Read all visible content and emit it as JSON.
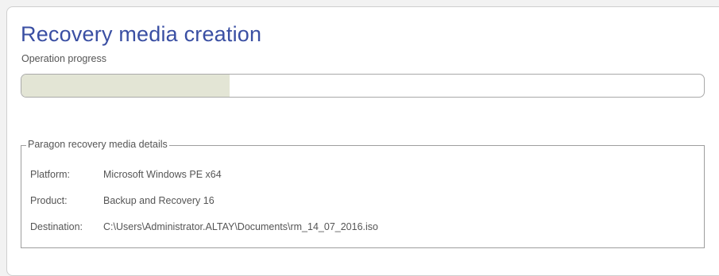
{
  "page": {
    "title": "Recovery media creation",
    "subtitle": "Operation progress"
  },
  "progress": {
    "fraction": 0.305
  },
  "details": {
    "legend": "Paragon recovery media details",
    "rows": [
      {
        "label": "Platform:",
        "value": "Microsoft Windows PE x64"
      },
      {
        "label": "Product:",
        "value": "Backup and Recovery 16"
      },
      {
        "label": "Destination:",
        "value": "C:\\Users\\Administrator.ALTAY\\Documents\\rm_14_07_2016.iso"
      }
    ]
  },
  "colors": {
    "title": "#3a4fa3",
    "progress_fill": "#e3e5d5",
    "text": "#555555"
  }
}
